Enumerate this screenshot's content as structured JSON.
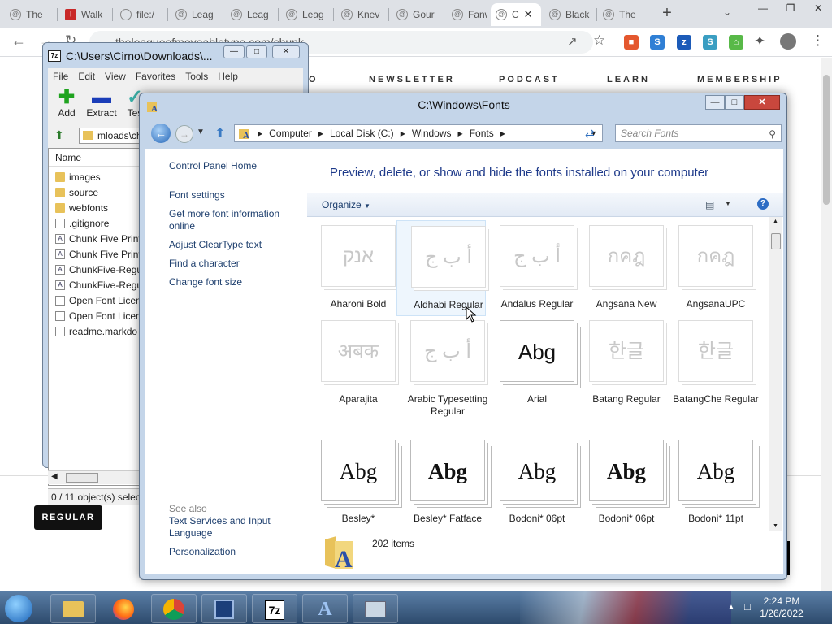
{
  "browser": {
    "tabs": [
      {
        "label": "The",
        "icon": "league-icon"
      },
      {
        "label": "Walk",
        "icon": "red-square-icon"
      },
      {
        "label": "file:/",
        "icon": "globe-icon"
      },
      {
        "label": "Leag",
        "icon": "league-icon"
      },
      {
        "label": "Leag",
        "icon": "league-icon"
      },
      {
        "label": "Leag",
        "icon": "league-icon"
      },
      {
        "label": "Knev",
        "icon": "league-icon"
      },
      {
        "label": "Gour",
        "icon": "league-icon"
      },
      {
        "label": "Fanw",
        "icon": "league-icon"
      },
      {
        "label": "C",
        "icon": "league-icon",
        "active": true
      },
      {
        "label": "Black",
        "icon": "league-icon"
      },
      {
        "label": "The",
        "icon": "league-icon"
      }
    ],
    "url": "theleagueofmoveabletype.com/chunk"
  },
  "site": {
    "nav": [
      "O",
      "NEWSLETTER",
      "PODCAST",
      "LEARN",
      "MEMBERSHIP"
    ],
    "regular_button": "REGULAR"
  },
  "zip": {
    "title": "C:\\Users\\Cirno\\Downloads\\...",
    "menu": [
      "File",
      "Edit",
      "View",
      "Favorites",
      "Tools",
      "Help"
    ],
    "tools": [
      "Add",
      "Extract",
      "Tes"
    ],
    "address": "mloads\\ch",
    "column": "Name",
    "files": [
      {
        "name": "images",
        "type": "folder"
      },
      {
        "name": "source",
        "type": "folder"
      },
      {
        "name": "webfonts",
        "type": "folder"
      },
      {
        "name": ".gitignore",
        "type": "file"
      },
      {
        "name": "Chunk Five Print",
        "type": "font"
      },
      {
        "name": "Chunk Five Print",
        "type": "font"
      },
      {
        "name": "ChunkFive-Regu",
        "type": "font"
      },
      {
        "name": "ChunkFive-Regu",
        "type": "font"
      },
      {
        "name": "Open Font Licen",
        "type": "file"
      },
      {
        "name": "Open Font Licen",
        "type": "file"
      },
      {
        "name": "readme.markdo",
        "type": "file"
      }
    ],
    "status": "0 / 11 object(s) selec"
  },
  "fonts_window": {
    "title": "C:\\Windows\\Fonts",
    "breadcrumb": [
      "Computer",
      "Local Disk (C:)",
      "Windows",
      "Fonts"
    ],
    "search_placeholder": "Search Fonts",
    "sidebar": {
      "control_panel_home": "Control Panel Home",
      "font_settings": "Font settings",
      "more_info": "Get more font information online",
      "cleartype": "Adjust ClearType text",
      "find_char": "Find a character",
      "change_size": "Change font size",
      "see_also": "See also",
      "text_services": "Text Services and Input Language",
      "personalization": "Personalization"
    },
    "heading": "Preview, delete, or show and hide the fonts installed on your computer",
    "organize": "Organize",
    "items_count": "202 items",
    "fonts": [
      {
        "name": "Aharoni Bold",
        "sample": "אנק",
        "style": "hidden"
      },
      {
        "name": "Aldhabi Regular",
        "sample": "أ ب ج",
        "style": "hidden",
        "selected": true
      },
      {
        "name": "Andalus Regular",
        "sample": "أ ب ج",
        "style": "hidden"
      },
      {
        "name": "Angsana New",
        "sample": "กคฎ",
        "style": "hidden"
      },
      {
        "name": "AngsanaUPC",
        "sample": "กคฎ",
        "style": "hidden"
      },
      {
        "name": "Aparajita",
        "sample": "अबक",
        "style": "hidden"
      },
      {
        "name": "Arabic Typesetting Regular",
        "sample": "أ ب ج",
        "style": "hidden"
      },
      {
        "name": "Arial",
        "sample": "Abg",
        "style": "sans"
      },
      {
        "name": "Batang Regular",
        "sample": "한글",
        "style": "hidden"
      },
      {
        "name": "BatangChe Regular",
        "sample": "한글",
        "style": "hidden"
      },
      {
        "name": "Besley*",
        "sample": "Abg",
        "style": "serif"
      },
      {
        "name": "Besley* Fatface",
        "sample": "Abg",
        "style": "bold"
      },
      {
        "name": "Bodoni* 06pt",
        "sample": "Abg",
        "style": "serif"
      },
      {
        "name": "Bodoni* 06pt",
        "sample": "Abg",
        "style": "bold"
      },
      {
        "name": "Bodoni* 11pt",
        "sample": "Abg",
        "style": "serif"
      }
    ]
  },
  "taskbar": {
    "items": [
      "explorer",
      "firefox",
      "chrome",
      "virtualbox",
      "7z",
      "fonts",
      "control-panel"
    ],
    "zip_label": "7z",
    "time": "2:24 PM",
    "date": "1/26/2022"
  }
}
